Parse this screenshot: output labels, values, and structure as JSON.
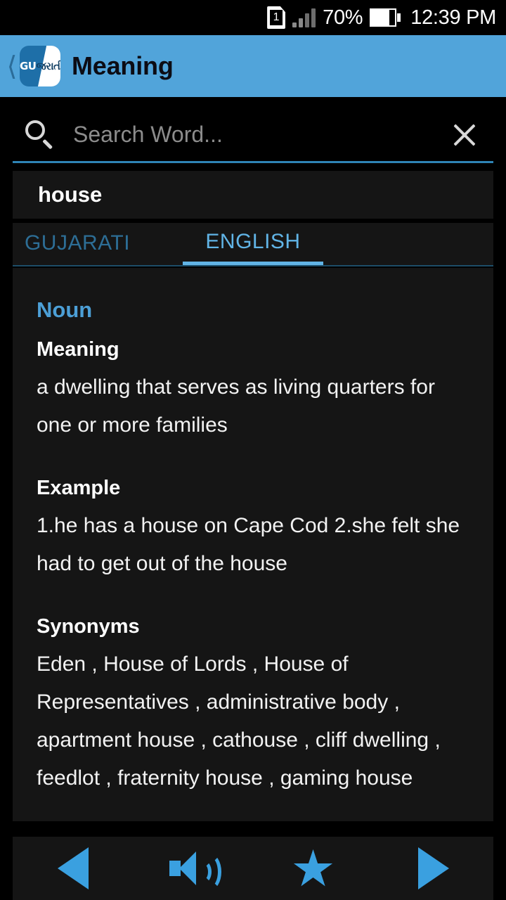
{
  "status_bar": {
    "sim_icon": "sim-card-icon",
    "sim_number": "1",
    "signal_icon": "signal-bars-icon",
    "battery_percent": "70%",
    "battery_icon": "battery-icon",
    "clock": "12:39 PM"
  },
  "header": {
    "back_icon": "back-chevron-icon",
    "logo_icon": "app-logo-icon",
    "logo_text_latin": "GU",
    "logo_text_gujarati": "જરાતી",
    "title": "Meaning",
    "background_color": "#51A4DA",
    "title_color": "#0c0c14"
  },
  "search": {
    "icon": "search-icon",
    "value": "",
    "placeholder": "Search Word...",
    "clear_icon": "close-icon",
    "underline_color": "#2e84b5"
  },
  "word_card": {
    "word": "house"
  },
  "tabs": [
    {
      "label": "GUJARATI",
      "active": false,
      "color": "#2d6e96"
    },
    {
      "label": "ENGLISH",
      "active": true,
      "color": "#61b4e6"
    }
  ],
  "content": {
    "part_of_speech": "Noun",
    "part_of_speech_color": "#4c9fd6",
    "sections": [
      {
        "label": "Meaning",
        "body": "a dwelling that serves as living quarters for one or more families"
      },
      {
        "label": "Example",
        "body": "1.he has a house on Cape Cod 2.she felt she had to get out of the house"
      },
      {
        "label": "Synonyms",
        "body": "Eden , House of Lords , House of Representatives , administrative body , apartment house , cathouse , cliff dwelling , feedlot , fraternity house , gaming house"
      }
    ]
  },
  "bottom_nav": {
    "accent_color": "#3AA0E0",
    "items": [
      {
        "name": "previous-button",
        "icon": "triangle-left-icon"
      },
      {
        "name": "speak-button",
        "icon": "speaker-icon"
      },
      {
        "name": "favorite-button",
        "icon": "star-icon",
        "glyph": "★"
      },
      {
        "name": "next-button",
        "icon": "triangle-right-icon"
      }
    ]
  }
}
